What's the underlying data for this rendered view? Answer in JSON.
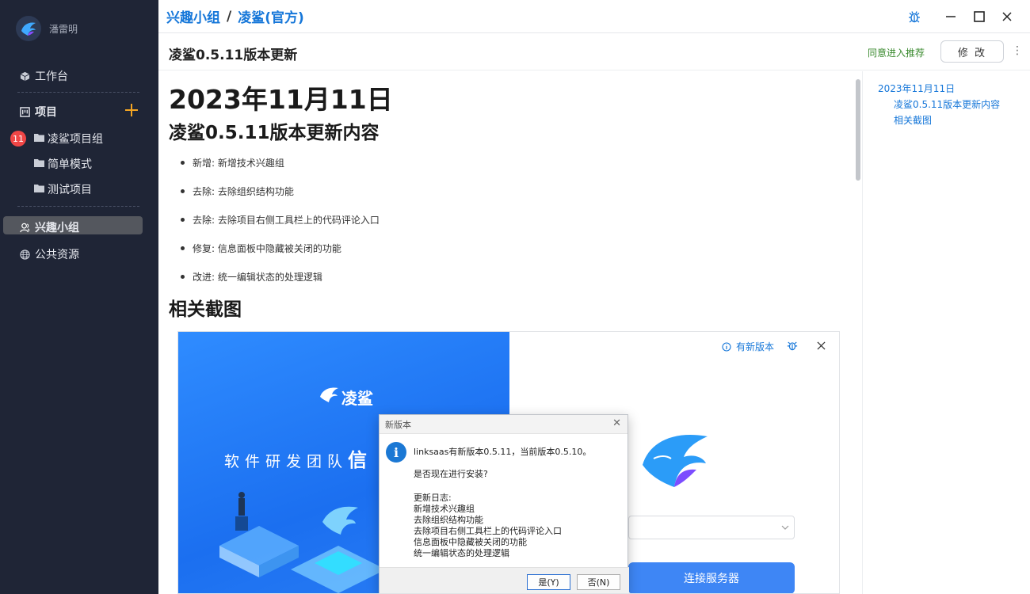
{
  "sidebar": {
    "username": "潘雷明",
    "workbench": "工作台",
    "projects_header": "项目",
    "project_groups": [
      {
        "label": "凌鲨项目组",
        "badge": "11"
      },
      {
        "label": "简单模式"
      },
      {
        "label": "测试项目"
      }
    ],
    "interest_group": "兴趣小组",
    "public_resources": "公共资源"
  },
  "topbar": {
    "crumb_parent": "兴趣小组",
    "crumb_sep": "/",
    "crumb_current": "凌鲨(官方)"
  },
  "doc": {
    "title": "凌鲨0.5.11版本更新",
    "recommend": "同意进入推荐",
    "edit": "修 改",
    "more": "⋮"
  },
  "content": {
    "h1": "2023年11月11日",
    "h2_update": "凌鲨0.5.11版本更新内容",
    "items": [
      "新增: 新增技术兴趣组",
      "去除: 去除组织结构功能",
      "去除: 去除项目右侧工具栏上的代码评论入口",
      "修复: 信息面板中隐藏被关闭的功能",
      "改进: 统一编辑状态的处理逻辑"
    ],
    "h2_screens": "相关截图"
  },
  "screenshot": {
    "logo_text": "凌鲨",
    "slogan": "软件研发团队",
    "slogan_tail": "信",
    "new_version": "有新版本",
    "connect": "连接服务器",
    "dialog": {
      "title": "新版本",
      "line1": "linksaas有新版本0.5.11，当前版本0.5.10。",
      "line2": "是否现在进行安装?",
      "log_title": "更新日志:",
      "log": [
        "新增技术兴趣组",
        "去除组织结构功能",
        "去除项目右侧工具栏上的代码评论入口",
        "信息面板中隐藏被关闭的功能",
        "统一编辑状态的处理逻辑"
      ],
      "yes": "是(Y)",
      "no": "否(N)"
    }
  },
  "toc": {
    "items": [
      {
        "label": "2023年11月11日"
      },
      {
        "label": "凌鲨0.5.11版本更新内容"
      },
      {
        "label": "相关截图"
      }
    ]
  },
  "colors": {
    "sidebar_bg": "#1f2536",
    "accent": "#1677d9",
    "badge": "#f04646",
    "recommend": "#3a8a2e"
  }
}
